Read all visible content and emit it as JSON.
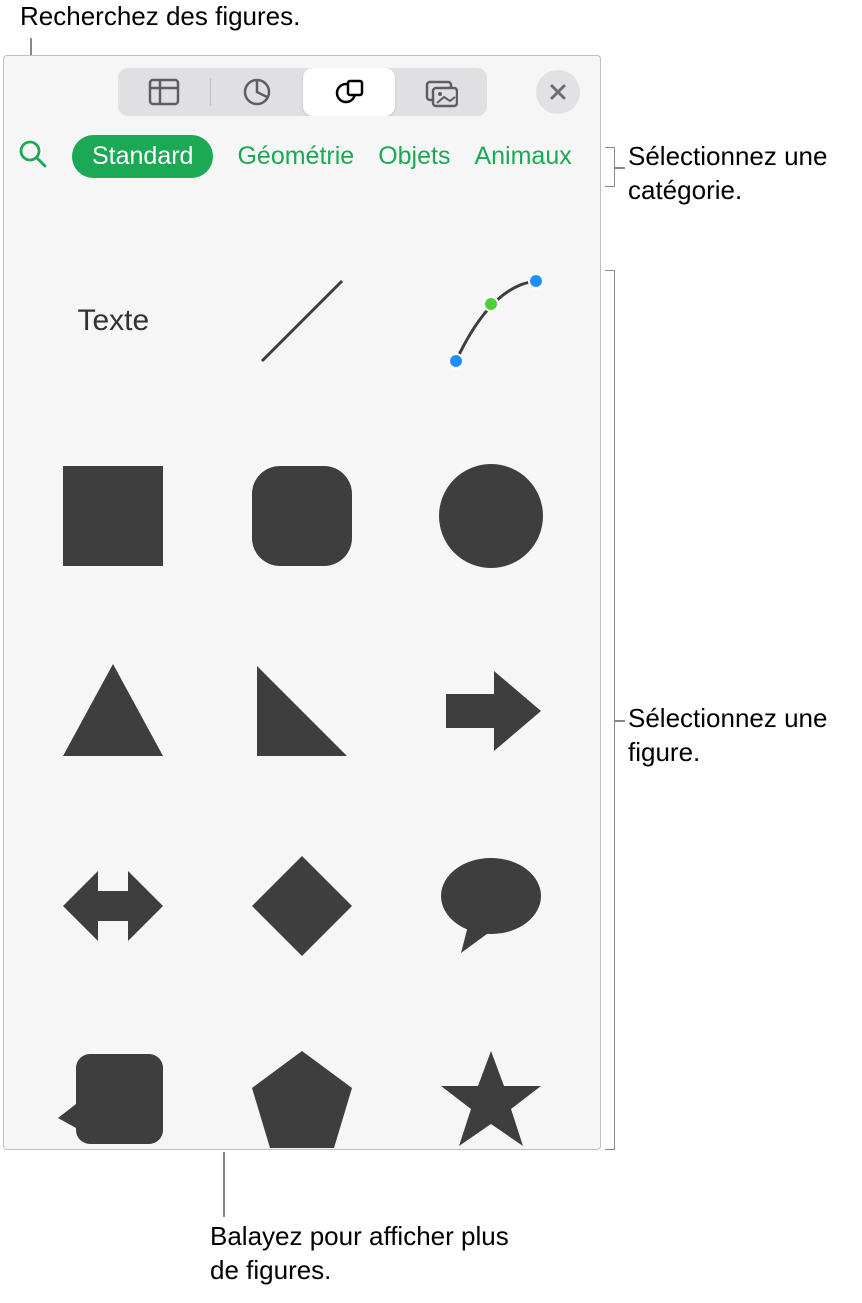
{
  "callouts": {
    "search": "Recherchez des figures.",
    "category": "Sélectionnez une catégorie.",
    "shape": "Sélectionnez une figure.",
    "swipe": "Balayez pour afficher plus de figures."
  },
  "toolbar": {
    "tabs": [
      "table",
      "chart",
      "shapes",
      "media"
    ],
    "active": "shapes"
  },
  "categories": {
    "active": "Standard",
    "items": [
      "Standard",
      "Géométrie",
      "Objets",
      "Animaux"
    ]
  },
  "shapes": {
    "text_label": "Texte",
    "items": [
      {
        "name": "text"
      },
      {
        "name": "line"
      },
      {
        "name": "curve"
      },
      {
        "name": "square"
      },
      {
        "name": "rounded-square"
      },
      {
        "name": "circle"
      },
      {
        "name": "triangle"
      },
      {
        "name": "right-triangle"
      },
      {
        "name": "arrow-right"
      },
      {
        "name": "arrow-left-right"
      },
      {
        "name": "diamond"
      },
      {
        "name": "speech-bubble"
      },
      {
        "name": "callout-square"
      },
      {
        "name": "pentagon"
      },
      {
        "name": "star"
      }
    ]
  }
}
